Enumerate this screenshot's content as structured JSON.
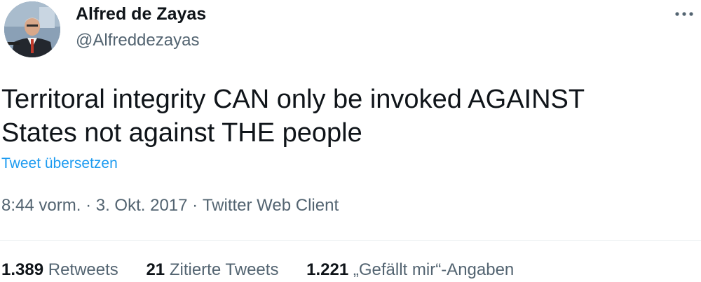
{
  "author": {
    "name": "Alfred de Zayas",
    "handle": "@Alfreddezayas"
  },
  "icons": {
    "more": "more-horizontal-icon",
    "avatar": "profile-photo"
  },
  "tweet": {
    "text_line1": "Territoral integrity CAN only be invoked AGAINST",
    "text_line2": "States not against THE people",
    "translate_label": "Tweet übersetzen"
  },
  "meta": {
    "time": "8:44 vorm.",
    "separator": "·",
    "date": "3. Okt. 2017",
    "client": "Twitter Web Client"
  },
  "stats": [
    {
      "count": "1.389",
      "label": "Retweets"
    },
    {
      "count": "21",
      "label": "Zitierte Tweets"
    },
    {
      "count": "1.221",
      "label": "„Gefällt mir“-Angaben"
    }
  ],
  "colors": {
    "text": "#0f1419",
    "secondary": "#536471",
    "link": "#1d9bf0",
    "divider": "#eff3f4"
  }
}
